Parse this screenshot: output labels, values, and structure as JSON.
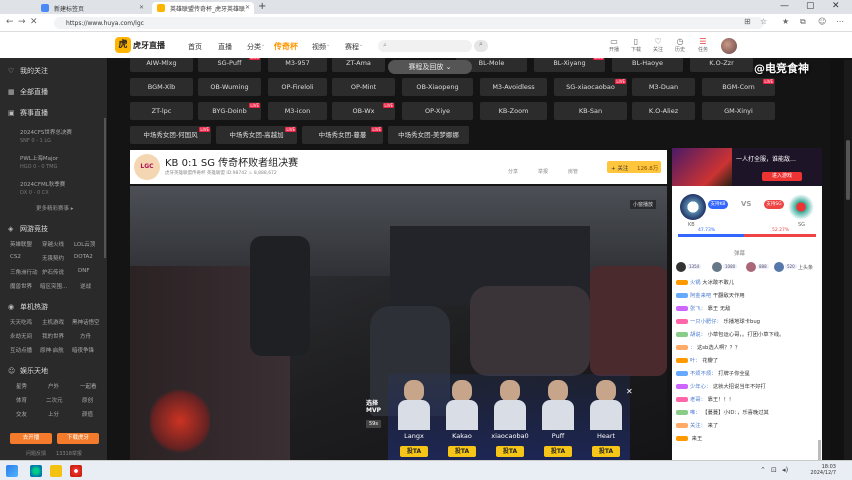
{
  "browser": {
    "tabs": [
      {
        "label": "新建标签页"
      },
      {
        "label": "英雄联盟传奇杯_虎牙英雄联"
      }
    ],
    "url": "https://www.huya.com/lgc"
  },
  "site": {
    "logo_text": "虎牙直播",
    "nav": [
      "首页",
      "直播",
      "分类",
      "传奇杯",
      "视频",
      "赛程"
    ],
    "search_placeholder": "",
    "header_icons": [
      {
        "name": "开播",
        "glyph": "▭"
      },
      {
        "name": "下载",
        "glyph": "▯"
      },
      {
        "name": "关注",
        "glyph": "♡"
      },
      {
        "name": "历史",
        "glyph": "◷"
      },
      {
        "name": "任务",
        "glyph": "☰"
      }
    ]
  },
  "sidebar": {
    "my_follow": "我的关注",
    "all_live": "全部直播",
    "events_title": "赛事直播",
    "events": [
      {
        "name": "2024CFS世界总决赛",
        "score": "SNF 0 - 1 LG"
      },
      {
        "name": "PWL上海Major",
        "score": "HGO 0 - 0 TMG"
      },
      {
        "name": "2024CFML秋季赛",
        "score": "DX 0 - 0 CX"
      }
    ],
    "more_events": "更多精彩赛事 ▸",
    "online_title": "网游竞技",
    "online_rows": [
      [
        "英雄联盟",
        "穿越火线",
        "LOL云顶"
      ],
      [
        "CS2",
        "无畏契约",
        "DOTA2"
      ],
      [
        "三角洲行动",
        "炉石传说",
        "DNF"
      ],
      [
        "魔兽世界",
        "暗区突围...",
        "逆战"
      ]
    ],
    "single_title": "单机热游",
    "single_rows": [
      [
        "天天吃鸡",
        "主机游戏",
        "黑神话悟空"
      ],
      [
        "永劫无间",
        "我的世界",
        "方舟"
      ],
      [
        "互动点播",
        "原神·启航",
        "暗夜争锋"
      ]
    ],
    "ent_title": "娱乐天地",
    "ent_rows": [
      [
        "星秀",
        "户外",
        "一起看"
      ],
      [
        "体育",
        "二次元",
        "原创"
      ],
      [
        "交友",
        "上分",
        "颜值"
      ]
    ],
    "btn_upload": "去开播",
    "btn_download": "下载虎牙",
    "footer": [
      "问题反馈",
      "13318举报"
    ]
  },
  "main": {
    "collapse_label": "赛程及回放",
    "watermark": "@电竞食神",
    "matchups_row1": [
      {
        "label": "AIW-Mlxg",
        "live": false
      },
      {
        "label": "SG-Puff",
        "live": true
      },
      {
        "label": "M3-957",
        "live": false
      },
      {
        "label": "ZT-Ama",
        "live": false
      },
      {
        "label": "BL-Mole",
        "live": false
      },
      {
        "label": "BL-Xiyang",
        "live": true
      },
      {
        "label": "BL-Haoye",
        "live": false
      },
      {
        "label": "K.O-Zzr",
        "live": false
      }
    ],
    "matchups_row2": [
      {
        "label": "BGM-Xlb",
        "live": false
      },
      {
        "label": "OB-Wuming",
        "live": false
      },
      {
        "label": "OP-Fireloli",
        "live": false
      },
      {
        "label": "OP-Mint",
        "live": false
      },
      {
        "label": "OB-Xiaopeng",
        "live": false
      },
      {
        "label": "M3-Avoidless",
        "live": false
      },
      {
        "label": "SG-xiaocaobao",
        "live": true
      },
      {
        "label": "M3-Duan",
        "live": false
      },
      {
        "label": "BGM-Corn",
        "live": true
      }
    ],
    "matchups_row3": [
      {
        "label": "ZT-lpc",
        "live": false
      },
      {
        "label": "BYG-Doinb",
        "live": true
      },
      {
        "label": "M3-icon",
        "live": false
      },
      {
        "label": "OB-Wx",
        "live": true
      },
      {
        "label": "OP-Xiye",
        "live": false
      },
      {
        "label": "KB-Zoom",
        "live": false
      },
      {
        "label": "KB-San",
        "live": false
      },
      {
        "label": "K.O-Aliez",
        "live": false
      },
      {
        "label": "GM-Xinyi",
        "live": false
      }
    ],
    "matchups_row4": [
      {
        "label": "中场秀女团-何国风",
        "live": true
      },
      {
        "label": "中场秀女团-高越加",
        "live": true
      },
      {
        "label": "中场秀女团-蔓蔓",
        "live": true
      },
      {
        "label": "中场秀女团-美梦娜娜",
        "live": false
      }
    ]
  },
  "room": {
    "logo": "LGC",
    "title": "KB 0:1 SG 传奇杯败者组决赛",
    "meta": "虎牙英雄联盟传奇杯   英雄联盟   ID:98742   ♨ 8,888,672",
    "actions": [
      "分享",
      "举报",
      "房管"
    ],
    "subscribe": "+ 关注",
    "subscribe_count": "126.8万"
  },
  "video": {
    "status": "小窗播放",
    "mvp_label_1": "选择",
    "mvp_label_2": "MVP",
    "mvp_score": "59s",
    "players": [
      {
        "name": "Langx",
        "vote": "投TA"
      },
      {
        "name": "Kakao",
        "vote": "投TA"
      },
      {
        "name": "xiaocaoba0",
        "vote": "投TA"
      },
      {
        "name": "Puff",
        "vote": "投TA"
      },
      {
        "name": "Heart",
        "vote": "投TA"
      }
    ]
  },
  "side": {
    "ad_title": "一人打全服，谁能敌…",
    "ad_btn": "进入游戏",
    "team_left": "KB",
    "team_right": "SG",
    "vs": "VS",
    "support_left": "支持KB",
    "support_right": "支持SG",
    "pct_left": "47.73%",
    "pct_right": "52.27%",
    "left_share": 0.4773,
    "chat_nav": "弹幕",
    "chat_top": "上头条",
    "fans": [
      "1354",
      "1080",
      "888",
      "520"
    ],
    "messages": [
      {
        "user": "火锅",
        "text": "大冰敢不敢儿"
      },
      {
        "user": "阿金来吧",
        "text": "干翻敌天作用"
      },
      {
        "user": "张飞：",
        "text": "靠王 无敌"
      },
      {
        "user": "一只小肥仔：",
        "text": "乐播地球卡bug"
      },
      {
        "user": "胡说：",
        "text": "小草包运心哥，。打团小草下线。"
      },
      {
        "user": "：",
        "text": "这sb选人啊？？？"
      },
      {
        "user": "叶：",
        "text": "花瓣了"
      },
      {
        "user": "不烦不烦：",
        "text": "打牌子你全星"
      },
      {
        "user": "少年心：",
        "text": "这就大招说当年不好打"
      },
      {
        "user": "老哥：",
        "text": "靠王！！！"
      },
      {
        "user": "唯：",
        "text": "【蔓蔓】小ID：，乐喜晚过其"
      },
      {
        "user": "关注：",
        "text": "来了"
      },
      {
        "user": "",
        "text": "来王"
      }
    ]
  },
  "taskbar": {
    "time": "18:03",
    "date": "2024/12/7"
  }
}
